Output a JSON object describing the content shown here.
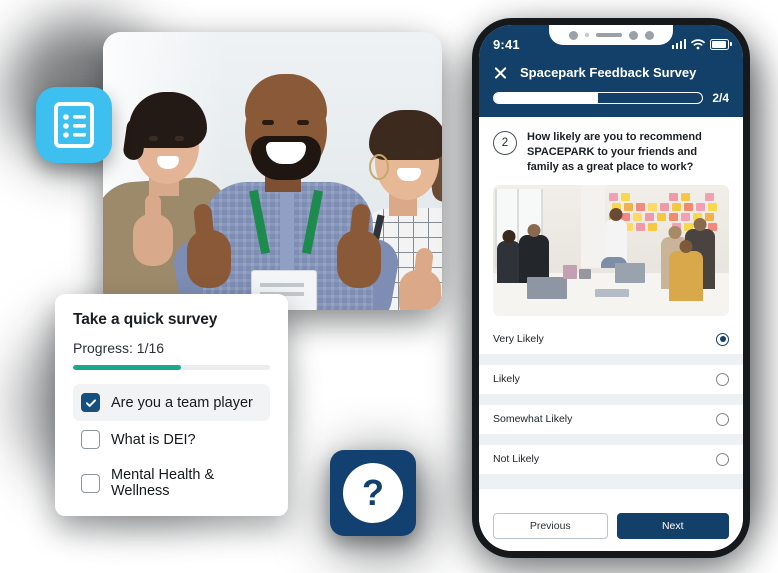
{
  "decor": {
    "form_icon": "form-list-icon",
    "help_icon": "question-mark-icon",
    "help_glyph": "?"
  },
  "photo": {
    "alt": "Three coworkers smiling and giving thumbs up"
  },
  "survey_card": {
    "title": "Take a quick survey",
    "progress_label": "Progress: 1/16",
    "progress_percent": 55,
    "items": [
      {
        "label": "Are you a team player",
        "checked": true
      },
      {
        "label": "What is DEI?",
        "checked": false
      },
      {
        "label": "Mental Health & Wellness",
        "checked": false
      }
    ]
  },
  "phone": {
    "status": {
      "time": "9:41",
      "signal": "signal-bars-icon",
      "wifi": "wifi-icon",
      "battery": "battery-icon"
    },
    "header": {
      "close_label": "close-icon",
      "title": "Spacepark Feedback Survey",
      "progress_text": "2/4",
      "progress_percent": 50
    },
    "question": {
      "number": "2",
      "text": "How likely are you to recommend SPACEPARK to your friends and family as a great place to work?",
      "image_alt": "Team workshop with sticky notes on a glass wall"
    },
    "options": [
      {
        "label": "Very Likely",
        "selected": true
      },
      {
        "label": "Likely",
        "selected": false
      },
      {
        "label": "Somewhat Likely",
        "selected": false
      },
      {
        "label": "Not Likely",
        "selected": false
      }
    ],
    "footer": {
      "previous": "Previous",
      "next": "Next"
    }
  },
  "colors": {
    "navy": "#134068",
    "cyan": "#3dc0ef",
    "teal": "#1aa98a",
    "checkbox_blue": "#16507f"
  }
}
